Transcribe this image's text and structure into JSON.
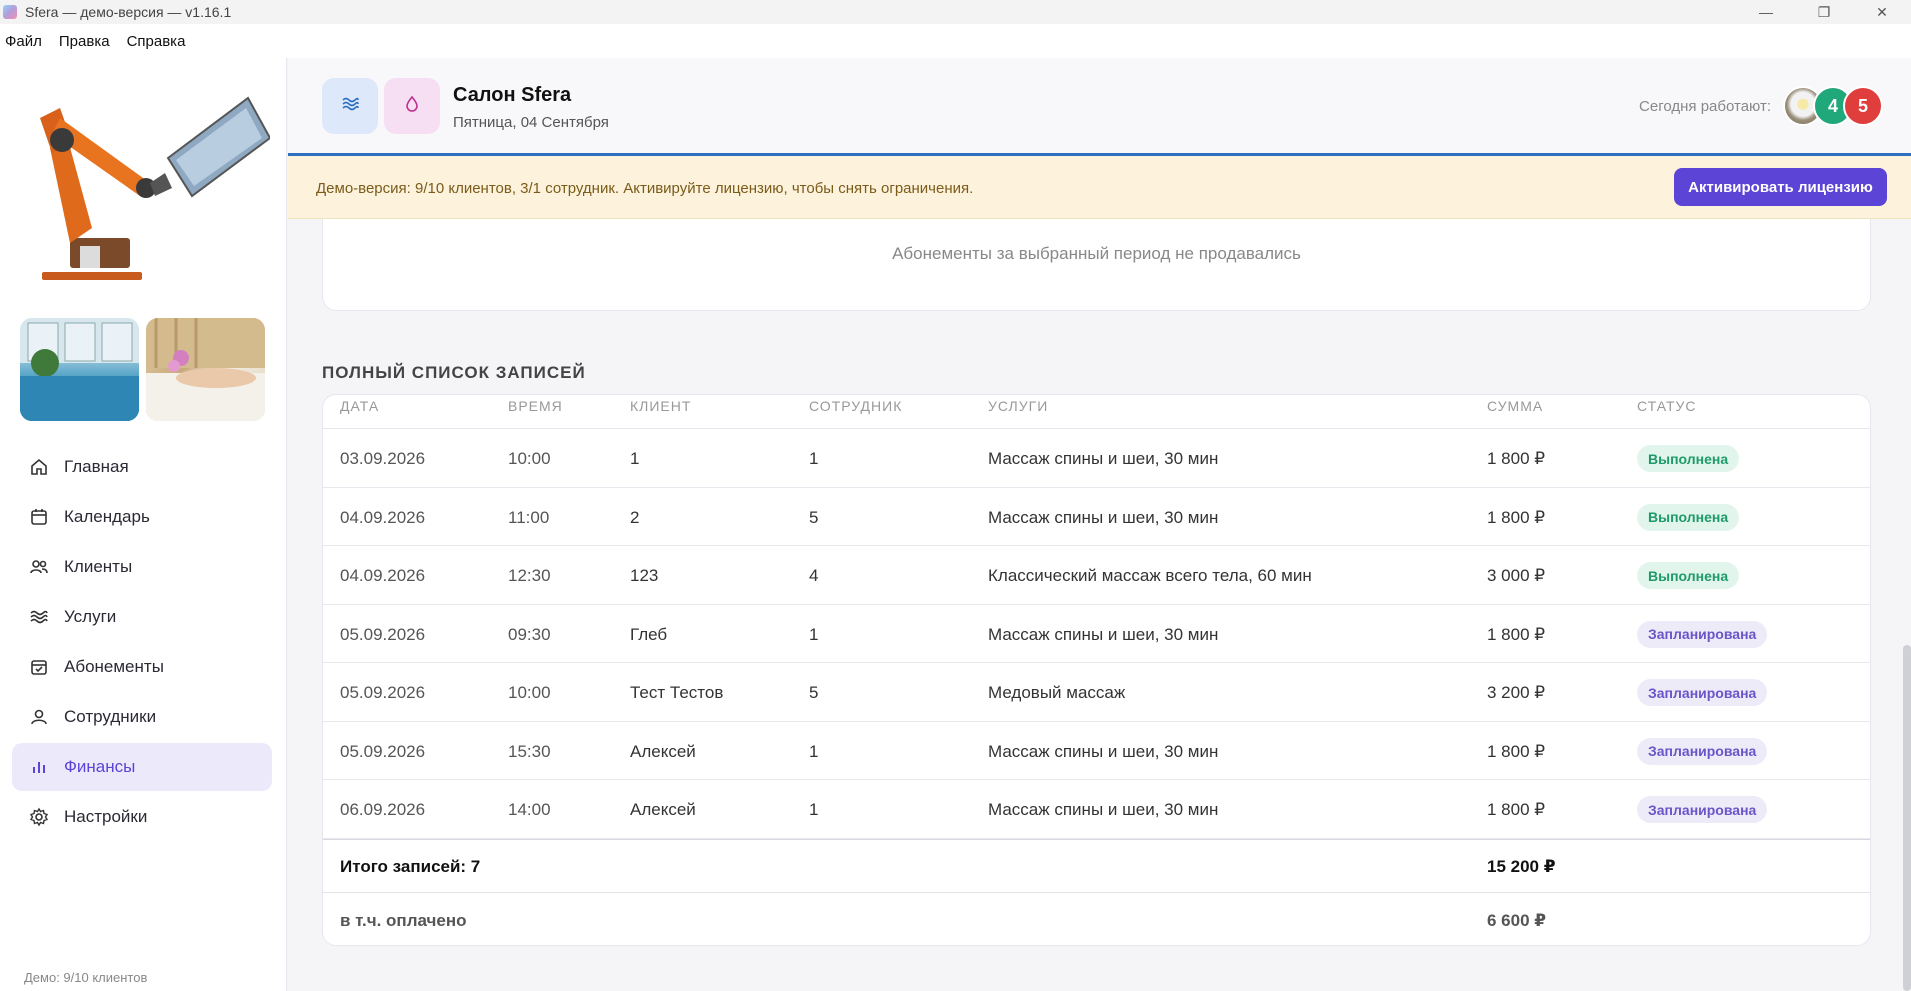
{
  "window": {
    "title": "Sfera — демо-версия — v1.16.1"
  },
  "menu": [
    "Файл",
    "Правка",
    "Справка"
  ],
  "sidebar": {
    "nav": [
      {
        "label": "Главная",
        "icon": "home-icon"
      },
      {
        "label": "Календарь",
        "icon": "calendar-icon"
      },
      {
        "label": "Клиенты",
        "icon": "users-icon"
      },
      {
        "label": "Услуги",
        "icon": "waves-icon"
      },
      {
        "label": "Абонементы",
        "icon": "calendar-check-icon"
      },
      {
        "label": "Сотрудники",
        "icon": "user-icon"
      },
      {
        "label": "Финансы",
        "icon": "bar-chart-icon",
        "active": true
      },
      {
        "label": "Настройки",
        "icon": "gear-icon"
      }
    ],
    "footer": "Демо: 9/10 клиентов"
  },
  "header": {
    "salon_name": "Салон Sfera",
    "date": "Пятница, 04 Сентября",
    "working_label": "Сегодня работают:",
    "working_avatars": [
      "4",
      "5"
    ]
  },
  "banner": {
    "text": "Демо-версия: 9/10 клиентов, 3/1 сотрудник. Активируйте лицензию, чтобы снять ограничения.",
    "button": "Активировать лицензию"
  },
  "subscriptions": {
    "empty_text": "Абонементы за выбранный период не продавались"
  },
  "records": {
    "title": "ПОЛНЫЙ СПИСОК ЗАПИСЕЙ",
    "columns": [
      "ДАТА",
      "ВРЕМЯ",
      "КЛИЕНТ",
      "СОТРУДНИК",
      "УСЛУГИ",
      "СУММА",
      "СТАТУС"
    ],
    "rows": [
      {
        "date": "03.09.2026",
        "time": "10:00",
        "client": "1",
        "staff": "1",
        "service": "Массаж спины и шеи, 30 мин",
        "sum": "1 800 ₽",
        "status": "Выполнена",
        "status_type": "done"
      },
      {
        "date": "04.09.2026",
        "time": "11:00",
        "client": "2",
        "staff": "5",
        "service": "Массаж спины и шеи, 30 мин",
        "sum": "1 800 ₽",
        "status": "Выполнена",
        "status_type": "done"
      },
      {
        "date": "04.09.2026",
        "time": "12:30",
        "client": "123",
        "staff": "4",
        "service": "Классический массаж всего тела, 60 мин",
        "sum": "3 000 ₽",
        "status": "Выполнена",
        "status_type": "done"
      },
      {
        "date": "05.09.2026",
        "time": "09:30",
        "client": "Глеб",
        "staff": "1",
        "service": "Массаж спины и шеи, 30 мин",
        "sum": "1 800 ₽",
        "status": "Запланирована",
        "status_type": "planned"
      },
      {
        "date": "05.09.2026",
        "time": "10:00",
        "client": "Тест Тестов",
        "staff": "5",
        "service": "Медовый массаж",
        "sum": "3 200 ₽",
        "status": "Запланирована",
        "status_type": "planned"
      },
      {
        "date": "05.09.2026",
        "time": "15:30",
        "client": "Алексей",
        "staff": "1",
        "service": "Массаж спины и шеи, 30 мин",
        "sum": "1 800 ₽",
        "status": "Запланирована",
        "status_type": "planned"
      },
      {
        "date": "06.09.2026",
        "time": "14:00",
        "client": "Алексей",
        "staff": "1",
        "service": "Массаж спины и шеи, 30 мин",
        "sum": "1 800 ₽",
        "status": "Запланирована",
        "status_type": "planned"
      }
    ],
    "total_label": "Итого записей: 7",
    "total_sum": "15 200 ₽",
    "paid_label": "в т.ч. оплачено",
    "paid_sum": "6 600 ₽"
  },
  "colors": {
    "accent": "#5b44d6",
    "done": "#1f9a6a",
    "planned": "#6a55c8",
    "header_border": "#2f6fc0"
  }
}
